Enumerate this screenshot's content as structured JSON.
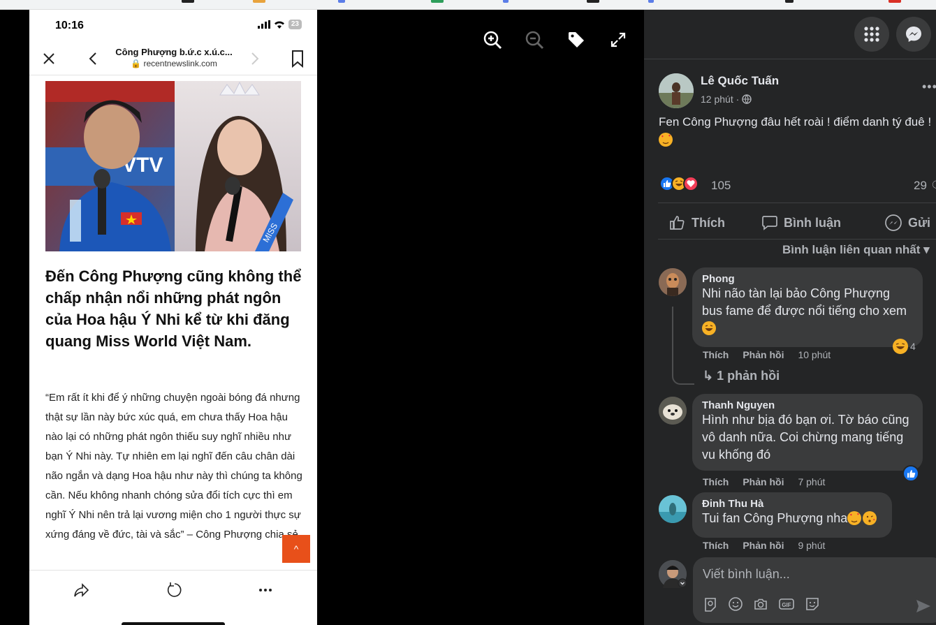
{
  "phone": {
    "status_time": "10:16",
    "battery": "23",
    "page_title": "Công Phượng b.ứ.c x.ú.c...",
    "page_url": "recentnewslink.com",
    "headline": "Đến Công Phượng cũng không thể chấp nhận nổi những phát ngôn của Hoa hậu Ý Nhi kể từ khi đăng quang Miss World Việt Nam.",
    "quote": "“Em rất ít khi để ý những chuyện ngoài bóng đá nhưng thật sự lần này bức xúc quá, em chưa thấy Hoa hậu nào lại có những phát ngôn thiếu suy nghĩ nhiều như bạn Ý Nhi này. Tự nhiên em lại nghĩ đến câu chân dài não ngắn và dạng Hoa hậu như này thì chúng ta không cần. Nếu không nhanh chóng sửa đổi tích cực thì em nghĩ Ý Nhi nên trả lại vương miện cho 1 người thực sự xứng đáng về đức, tài và sắc” – Công Phượng chia sẻ.",
    "photo_text": {
      "left_banner": "VTV",
      "right_banner": "MISS",
      "sash": "MISS"
    }
  },
  "post": {
    "author": "Lê Quốc Tuấn",
    "time": "12 phút ·",
    "text": "Fen Công Phượng đâu hết roài ! điểm danh tý đuê !",
    "reaction_count": "105",
    "comment_count": "29",
    "actions": {
      "like": "Thích",
      "comment": "Bình luận",
      "send": "Gửi"
    },
    "sort_label": "Bình luận liên quan nhất"
  },
  "comments": [
    {
      "name": "Phong",
      "text": "Nhi não tàn lại bảo Công Phượng bus fame để được nổi tiếng cho xem",
      "like": "Thích",
      "reply": "Phản hồi",
      "time": "10 phút",
      "reaction_count": "4",
      "replies_label": "1 phản hồi"
    },
    {
      "name": "Thanh Nguyen",
      "text": "Hình như bịa đó bạn ơi. Tờ báo cũng vô danh nữa. Coi chừng mang tiếng vu khống đó",
      "like": "Thích",
      "reply": "Phản hồi",
      "time": "7 phút"
    },
    {
      "name": "Đinh Thu Hà",
      "text": "Tui fan Công Phượng nha",
      "like": "Thích",
      "reply": "Phản hồi",
      "time": "9 phút"
    }
  ],
  "composer": {
    "placeholder": "Viết bình luận..."
  },
  "colors": {
    "panel_bg": "#242526",
    "bubble_bg": "#3a3b3c",
    "like_blue": "#1877f2",
    "love_red": "#f33e58",
    "haha_yellow": "#f7b125",
    "scroll_button": "#e8501a"
  }
}
